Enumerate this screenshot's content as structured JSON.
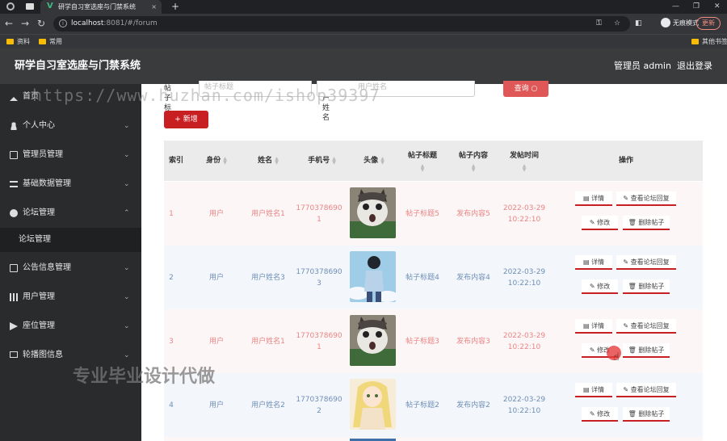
{
  "browser": {
    "tab_title": "研学自习室选座与门禁系统",
    "url_host": "localhost",
    "url_rest": ":8081/#/forum",
    "incognito": "无痕模式",
    "update": "更新",
    "bookmarks": [
      "资料",
      "常用"
    ],
    "other_bookmarks": "其他书签"
  },
  "header": {
    "title": "研学自习室选座与门禁系统",
    "admin": "管理员 admin",
    "logout": "退出登录"
  },
  "sidebar": {
    "items": [
      {
        "label": "首页",
        "icon": "home-icon"
      },
      {
        "label": "个人中心",
        "icon": "user-icon"
      },
      {
        "label": "管理员管理",
        "icon": "admin-icon"
      },
      {
        "label": "基础数据管理",
        "icon": "list-icon"
      },
      {
        "label": "论坛管理",
        "icon": "globe-icon"
      },
      {
        "label": "公告信息管理",
        "icon": "notice-icon"
      },
      {
        "label": "用户管理",
        "icon": "chart-icon"
      },
      {
        "label": "座位管理",
        "icon": "plane-icon"
      },
      {
        "label": "轮播图信息",
        "icon": "mail-icon"
      }
    ],
    "sub_item": "论坛管理"
  },
  "search": {
    "title_label": "帖子标题",
    "title_placeholder": "帖子标题",
    "name_label": "用户姓名",
    "name_placeholder": "用户姓名",
    "query": "查询"
  },
  "add_button": "+ 新增",
  "table": {
    "headers": [
      "索引",
      "身份",
      "姓名",
      "手机号",
      "头像",
      "帖子标题",
      "帖子内容",
      "发帖时间",
      "操作"
    ],
    "buttons": {
      "detail": "详情",
      "replies": "查看论坛回复",
      "edit": "修改",
      "delete": "删除帖子"
    },
    "rows": [
      {
        "index": "1",
        "role": "用户",
        "name": "用户姓名1",
        "phone": "1770378690 1",
        "title": "帖子标题5",
        "content": "发布内容5",
        "date": "2022-03-29",
        "time": "10:22:10"
      },
      {
        "index": "2",
        "role": "用户",
        "name": "用户姓名3",
        "phone": "1770378690 3",
        "title": "帖子标题4",
        "content": "发布内容4",
        "date": "2022-03-29",
        "time": "10:22:10"
      },
      {
        "index": "3",
        "role": "用户",
        "name": "用户姓名1",
        "phone": "1770378690 1",
        "title": "帖子标题3",
        "content": "发布内容3",
        "date": "2022-03-29",
        "time": "10:22:10"
      },
      {
        "index": "4",
        "role": "用户",
        "name": "用户姓名2",
        "phone": "1770378690 2",
        "title": "帖子标题2",
        "content": "发布内容2",
        "date": "2022-03-29",
        "time": "10:22:10"
      }
    ]
  },
  "watermarks": {
    "url": "https://www.huzhan.com/ishop39397",
    "text": "专业毕业设计代做"
  }
}
